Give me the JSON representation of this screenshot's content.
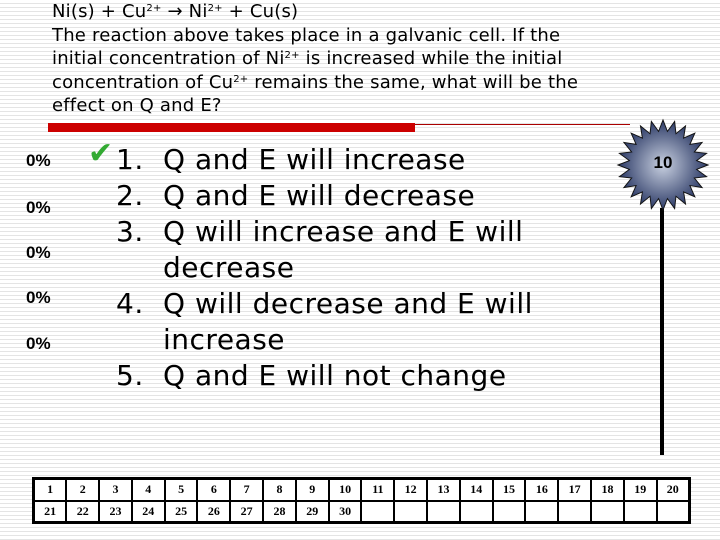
{
  "question": {
    "equation": {
      "left": "Ni(s) + Cu",
      "cu_charge": "2+",
      "arrow": "→",
      "ni": " Ni",
      "ni_charge": "2+",
      "right": " + Cu(s)"
    },
    "line2": "The reaction above takes place in a galvanic cell.  If the",
    "line3a": "initial concentration of Ni",
    "line3_charge": "2+",
    "line3b": " is increased while the initial",
    "line4a": "concentration of Cu",
    "line4_charge": "2+",
    "line4b": "  remains the same, what will be the",
    "line5": "effect on Q and E?"
  },
  "percentages": [
    "0%",
    "0%",
    "0%",
    "0%",
    "0%"
  ],
  "answers": [
    {
      "num": "1.",
      "text": "Q and E will increase",
      "correct": true
    },
    {
      "num": "2.",
      "text": "Q and E will decrease"
    },
    {
      "num": "3.",
      "text": "Q will increase and E will decrease"
    },
    {
      "num": "4.",
      "text": "Q will decrease and E will increase"
    },
    {
      "num": "5.",
      "text": "Q and E will not change"
    }
  ],
  "check_icon": "✔",
  "timer": {
    "value": "10",
    "icon": "starburst-countdown"
  },
  "participants": {
    "row1": [
      "1",
      "2",
      "3",
      "4",
      "5",
      "6",
      "7",
      "8",
      "9",
      "10",
      "11",
      "12",
      "13",
      "14",
      "15",
      "16",
      "17",
      "18",
      "19",
      "20"
    ],
    "row2": [
      "21",
      "22",
      "23",
      "24",
      "25",
      "26",
      "27",
      "28",
      "29",
      "30",
      "",
      "",
      "",
      "",
      "",
      "",
      "",
      "",
      "",
      ""
    ]
  },
  "colors": {
    "accent_bar": "#cc0000",
    "check": "#33aa33",
    "timer": "#3a4a70"
  }
}
